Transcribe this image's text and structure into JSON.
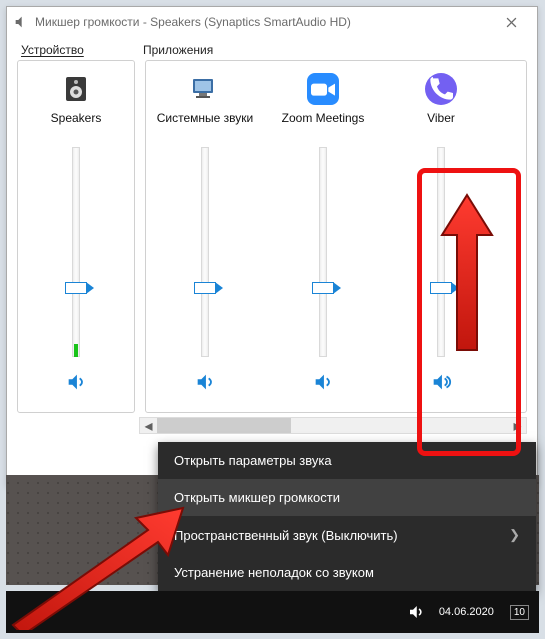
{
  "window": {
    "title": "Микшер громкости - Speakers (Synaptics SmartAudio HD)"
  },
  "sections": {
    "device_label": "Устройство",
    "apps_label": "Приложения"
  },
  "channels": {
    "device": {
      "name": "Speakers",
      "level": 30,
      "meter": 6
    },
    "apps": [
      {
        "name": "Системные звуки",
        "level": 30,
        "meter": 0
      },
      {
        "name": "Zoom Meetings",
        "level": 30,
        "meter": 0
      },
      {
        "name": "Viber",
        "level": 30,
        "meter": 0
      }
    ]
  },
  "scrollbar": {
    "thumb_percent": 38
  },
  "context_menu": {
    "items": [
      {
        "label": "Открыть параметры звука",
        "submenu": false,
        "hover": false
      },
      {
        "label": "Открыть микшер громкости",
        "submenu": false,
        "hover": true
      },
      {
        "label": "Пространственный звук (Выключить)",
        "submenu": true,
        "hover": false
      },
      {
        "label": "Устранение неполадок со звуком",
        "submenu": false,
        "hover": false
      }
    ]
  },
  "taskbar": {
    "date": "04.06.2020",
    "lang": "10"
  }
}
